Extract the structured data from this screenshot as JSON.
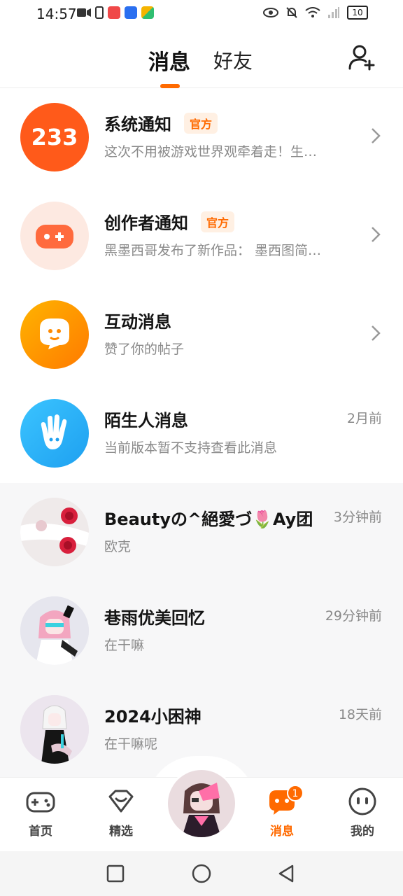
{
  "status_bar": {
    "time": "14:57",
    "battery": "10",
    "left_icons": [
      "video-icon",
      "sim-icon",
      "app-red-icon",
      "app-blue-icon",
      "app-multicolor-icon"
    ],
    "right_icons": [
      "eye-icon",
      "mute-icon",
      "wifi-icon",
      "signal-icon",
      "battery-icon"
    ]
  },
  "header": {
    "tabs": [
      {
        "label": "消息",
        "active": true
      },
      {
        "label": "好友",
        "active": false
      }
    ],
    "add_friend_icon": "add-friend-icon",
    "accent": "#ff6a00"
  },
  "messages": [
    {
      "title": "系统通知",
      "badge": "官方",
      "subtitle": "这次不用被游戏世界观牵着走！生…",
      "time": "",
      "avatar": "233-logo",
      "chevron": true
    },
    {
      "title": "创作者通知",
      "badge": "官方",
      "subtitle": "黑墨西哥发布了新作品：  墨西图简…",
      "time": "",
      "avatar": "gamepad-plus-icon",
      "chevron": true
    },
    {
      "title": "互动消息",
      "badge": "",
      "subtitle": "赞了你的帖子",
      "time": "",
      "avatar": "chat-bubble-smile-icon",
      "chevron": true
    },
    {
      "title": "陌生人消息",
      "badge": "",
      "subtitle": "当前版本暂不支持查看此消息",
      "time": "2月前",
      "avatar": "waving-hand-icon",
      "chevron": false
    },
    {
      "title": "Beautyの^絕愛づ🌷Ay团",
      "badge": "",
      "subtitle": "欧克",
      "time": "3分钟前",
      "avatar": "user-avatar-roses",
      "chevron": false
    },
    {
      "title": "巷雨优美回忆",
      "badge": "",
      "subtitle": "在干嘛",
      "time": "29分钟前",
      "avatar": "user-avatar-pink-hair",
      "chevron": false
    },
    {
      "title": "2024小困神",
      "badge": "",
      "subtitle": "在干嘛呢",
      "time": "18天前",
      "avatar": "user-avatar-white-hair",
      "chevron": false
    }
  ],
  "bottom_nav": [
    {
      "label": "首页",
      "icon": "gamepad-icon",
      "active": false
    },
    {
      "label": "精选",
      "icon": "heart-gem-icon",
      "active": false
    },
    {
      "label": "消息",
      "icon": "message-bubble-icon",
      "active": true,
      "badge": "1"
    },
    {
      "label": "我的",
      "icon": "face-icon",
      "active": false
    }
  ],
  "system_nav": [
    "recent-apps-icon",
    "home-icon",
    "back-icon"
  ]
}
